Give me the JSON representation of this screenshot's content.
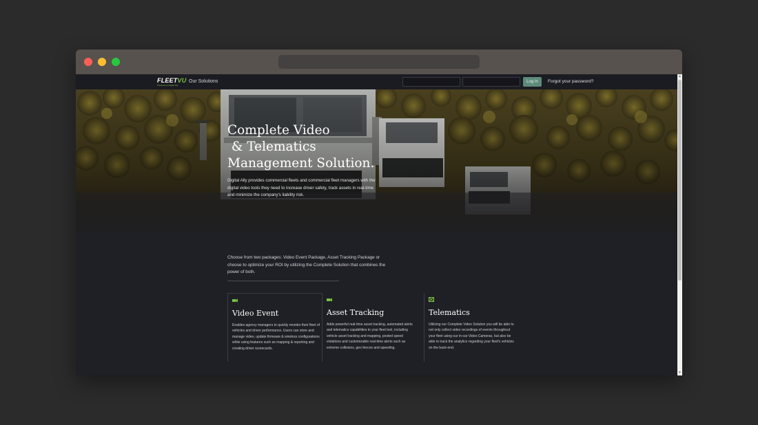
{
  "nav": {
    "logo_main": "FLEET",
    "logo_accent": "VU",
    "logo_tagline": "Powered by Digital Ally",
    "solutions_link": "Our Solutions",
    "login_label": "Log In",
    "forgot_link": "Forgot your password?"
  },
  "hero": {
    "title_lines": [
      "Complete Video",
      " & Telematics",
      "Management Solution."
    ],
    "description": "Digital Ally provides commercial fleets and commercial fleet managers with the digital video tools they need to increase driver safety, track assets in real-time and minimize the company's liability risk."
  },
  "intro": {
    "text": "Choose from two packages: Video Event Package, Asset Tracking Package or choose to optimize your ROI by utilizing the Complete Solution that combines the power of both."
  },
  "cards": [
    {
      "icon": "video-camera-icon",
      "title": "Video Event",
      "text": "Enables agency managers to quickly monitor their fleet of vehicles and driver performance. Users can store and manage video, update firmware & wireless configurations while using features such as mapping & reporting and creating driver scorecards."
    },
    {
      "icon": "video-camera-icon",
      "title": "Asset Tracking",
      "text": "Adds powerful real-time asset tracking, automated alerts and telematics capabilities to your fleet tool, including vehicle asset tracking and mapping, posted speed violations and customizable real-time alerts such as extreme collisions, geo fences and speeding."
    },
    {
      "icon": "telematics-icon",
      "title": "Telematics",
      "text": "Utilizing our Complete Video Solution you will be able to not only collect video recordings of events throughout your fleet using our in-car Video Cameras, but also be able to track the analytics regarding your fleet's vehicles on the back-end."
    }
  ],
  "colors": {
    "accent_green": "#7bc043",
    "login_button": "#5d8a7a",
    "page_background": "#1f1f26"
  }
}
